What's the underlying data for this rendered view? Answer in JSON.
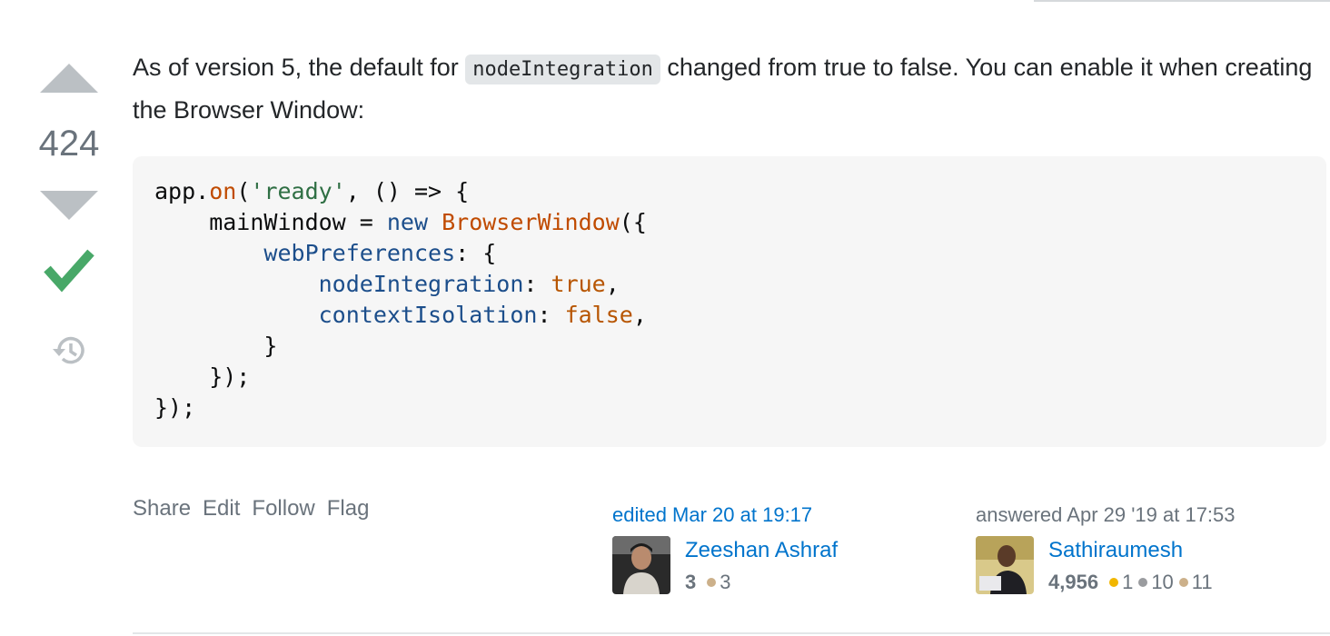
{
  "vote": {
    "count": "424"
  },
  "post": {
    "text_before": "As of version 5, the default for ",
    "inline_code": "nodeIntegration",
    "text_after": " changed from true to false. You can enable it when creating the Browser Window:"
  },
  "code": {
    "lines": [
      "app.on('ready', () => {",
      "    mainWindow = new BrowserWindow({",
      "        webPreferences: {",
      "            nodeIntegration: true,",
      "            contextIsolation: false,",
      "        }",
      "    });",
      "});"
    ]
  },
  "menu": {
    "share": "Share",
    "edit": "Edit",
    "follow": "Follow",
    "flag": "Flag"
  },
  "editor": {
    "action": "edited Mar 20 at 19:17",
    "name": "Zeeshan Ashraf",
    "rep": "3",
    "bronze": "3"
  },
  "owner": {
    "action": "answered Apr 29 '19 at 17:53",
    "name": "Sathiraumesh",
    "rep": "4,956",
    "gold": "1",
    "silver": "10",
    "bronze": "11"
  },
  "colors": {
    "accepted": "#48a868",
    "vote_arrow": "#bbc0c4",
    "link": "#0074cc"
  },
  "icons": [
    "upvote-icon",
    "downvote-icon",
    "accepted-check-icon",
    "history-icon"
  ]
}
